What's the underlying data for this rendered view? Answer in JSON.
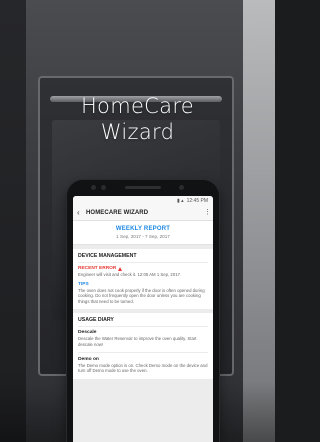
{
  "headline": {
    "line1": "HomeCare",
    "line2": "Wizard"
  },
  "status_bar": {
    "time": "12:45 PM",
    "icons": "▮ ▴"
  },
  "app_bar": {
    "back_icon": "‹",
    "title": "HOMECARE WIZARD",
    "more_icon": "⋮"
  },
  "report": {
    "title": "WEEKLY REPORT",
    "date_range": "1 Sep, 2017 - 7 Sep, 2017"
  },
  "device_management": {
    "heading": "DEVICE MANAGEMENT",
    "recent_error": {
      "label": "RECENT ERROR",
      "text": "Engineer will visit and check it. 12:05 AM 1 Sep, 2017"
    },
    "tips": {
      "label": "TIPS",
      "text": "The oven does not cook properly if the door is often opened during cooking. Do not frequently open the door unless you are cooking things that need to be turned."
    }
  },
  "usage_diary": {
    "heading": "USAGE DIARY",
    "items": [
      {
        "title": "Descale",
        "text": "Descale the Water Reservoir to improve the oven quality. Start descale now!"
      },
      {
        "title": "Demo on",
        "text": "The Demo mode option is on. Check Demo mode on the device and turn off Demo mode to use the oven."
      }
    ]
  },
  "colors": {
    "accent": "#1e88e5",
    "error": "#e53935"
  }
}
